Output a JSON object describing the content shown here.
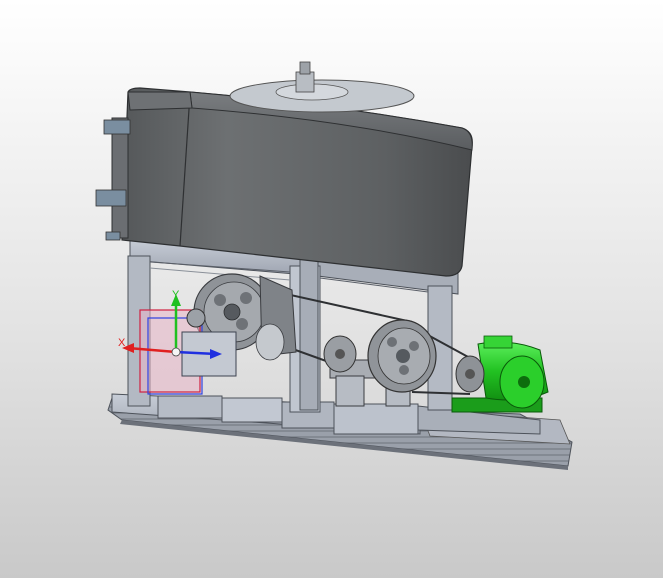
{
  "viewport": {
    "background_top": "#ffffff",
    "background_bottom": "#c9c9c9"
  },
  "model": {
    "body_color": "#636566",
    "frame_color": "#b9bfca",
    "pulley_color": "#8b8f94",
    "motor_color": "#2fd12f"
  },
  "triad": {
    "x_color": "#e02020",
    "y_color": "#20c020",
    "z_color": "#2030e0",
    "y_label": "Y",
    "x_label": "X"
  }
}
